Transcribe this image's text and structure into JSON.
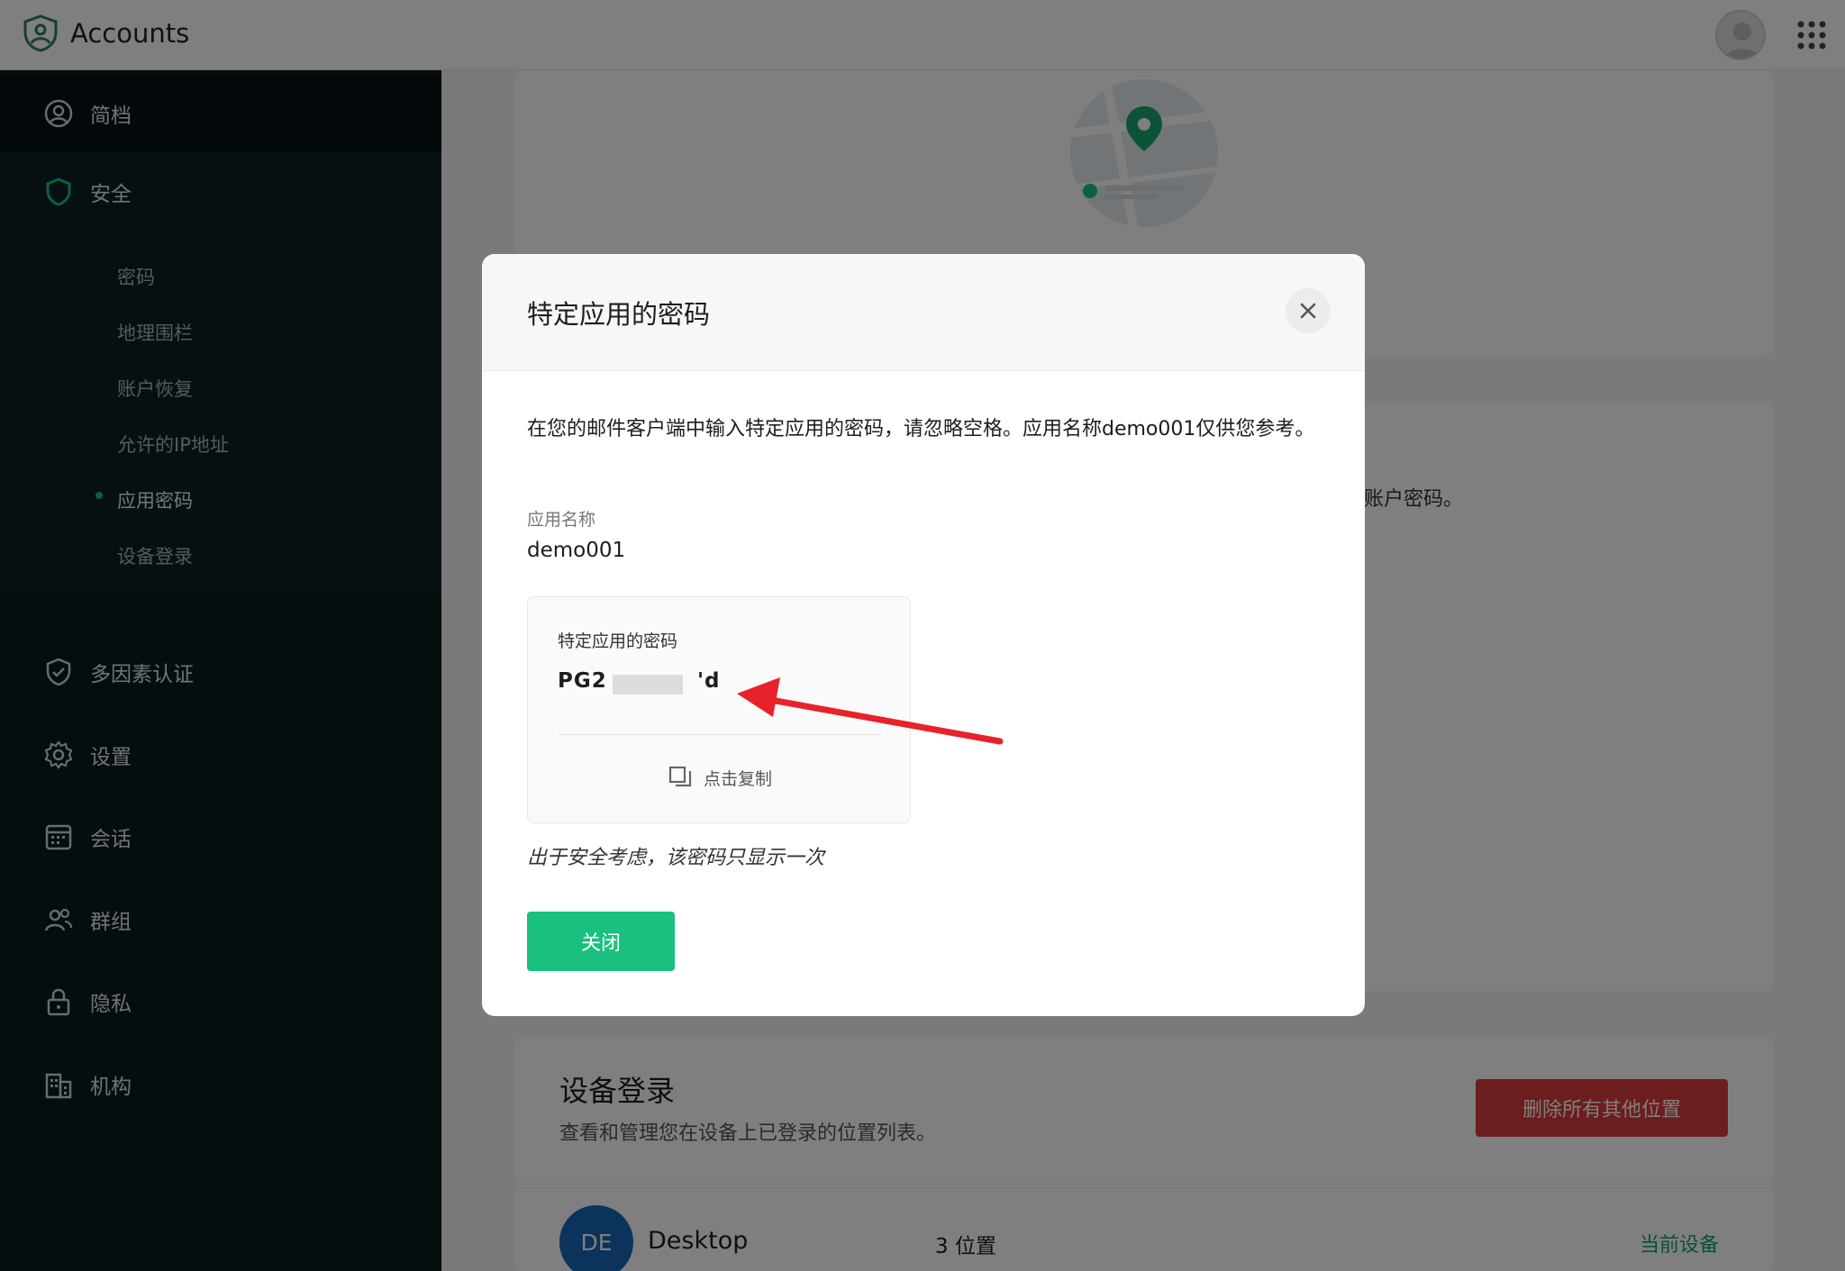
{
  "app": {
    "title": "Accounts"
  },
  "sidebar": {
    "profile": "简档",
    "security": "安全",
    "security_items": [
      "密码",
      "地理围栏",
      "账户恢复",
      "允许的IP地址",
      "应用密码",
      "设备登录"
    ],
    "active_item": "应用密码",
    "items": [
      "多因素认证",
      "设置",
      "会话",
      "群组",
      "隐私",
      "机构"
    ]
  },
  "background": {
    "partial_text": "账户密码。",
    "device_section": {
      "title": "设备登录",
      "subtitle": "查看和管理您在设备上已登录的位置列表。",
      "delete_button": "删除所有其他位置",
      "device": {
        "avatar": "DE",
        "name": "Desktop",
        "locations": "3 位置",
        "status": "当前设备"
      }
    }
  },
  "modal": {
    "title": "特定应用的密码",
    "description": "在您的邮件客户端中输入特定应用的密码，请忽略空格。应用名称demo001仅供您参考。",
    "app_name_label": "应用名称",
    "app_name_value": "demo001",
    "password_box": {
      "label": "特定应用的密码",
      "password_start": "PG2",
      "password_end": "'d",
      "copy_label": "点击复制"
    },
    "note": "出于安全考虑，该密码只显示一次",
    "close_button": "关闭"
  },
  "colors": {
    "primary": "#19c07f",
    "danger": "#d83b3b",
    "sidebar_bg": "#0a1a1f",
    "annotation_arrow": "#e8222b"
  }
}
